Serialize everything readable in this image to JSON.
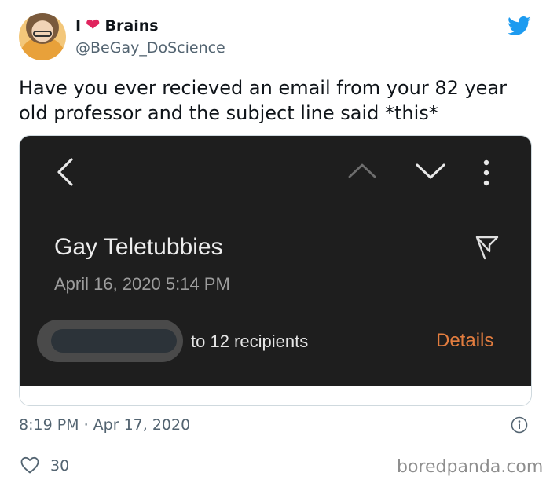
{
  "author": {
    "name_prefix": "I",
    "heart": "❤",
    "name_suffix": "Brains",
    "handle": "@BeGay_DoScience"
  },
  "tweet": {
    "text": "Have you ever recieved an email from your 82 year old professor and the subject line said *this*",
    "timestamp": "8:19 PM · Apr 17, 2020",
    "likes": "30"
  },
  "email_screenshot": {
    "subject": "Gay Teletubbies",
    "date": "April 16, 2020  5:14 PM",
    "recipients": "to 12 recipients",
    "details_label": "Details"
  },
  "icons": {
    "twitter": "twitter-bird-icon",
    "back": "chevron-left-icon",
    "up": "chevron-up-icon",
    "down": "chevron-down-icon",
    "more": "more-vertical-icon",
    "flag": "flag-icon",
    "info": "info-icon",
    "like": "heart-outline-icon"
  },
  "colors": {
    "twitter_blue": "#1d9bf0",
    "heart_red": "#e0245e",
    "details_orange": "#e37d3f",
    "email_bg": "#1e1e1e"
  },
  "watermark": "boredpanda.com"
}
